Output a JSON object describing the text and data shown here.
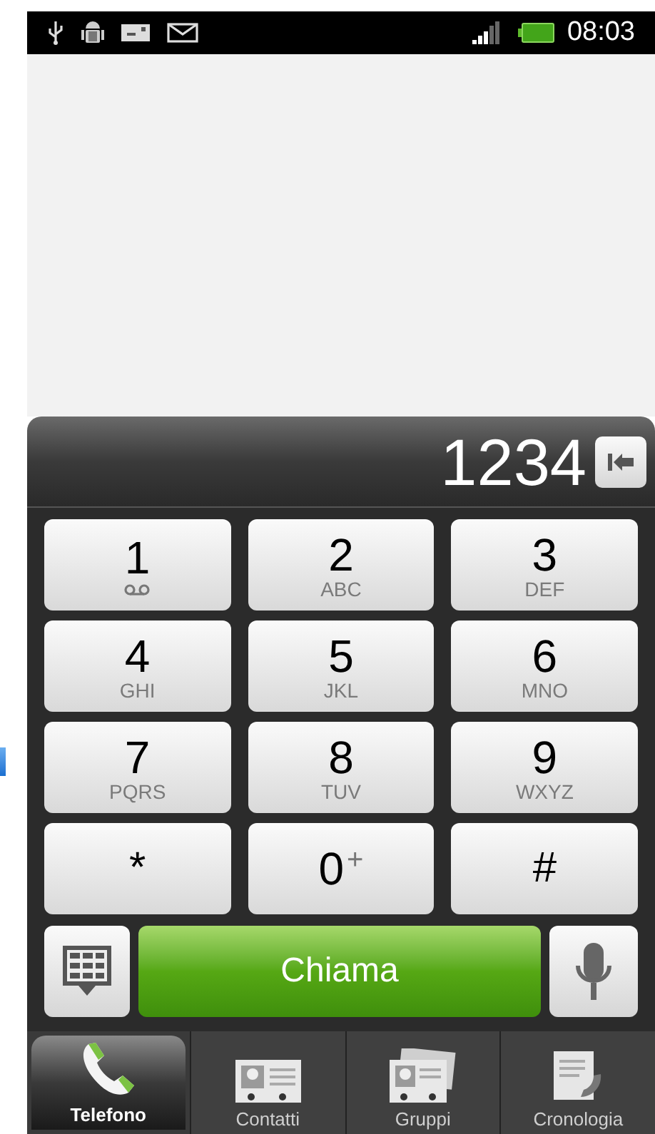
{
  "status_bar": {
    "time": "08:03"
  },
  "dialer": {
    "number": "1234"
  },
  "keys": [
    {
      "digit": "1",
      "kind": "voicemail"
    },
    {
      "digit": "2",
      "letters": "ABC",
      "kind": "digit"
    },
    {
      "digit": "3",
      "letters": "DEF",
      "kind": "digit"
    },
    {
      "digit": "4",
      "letters": "GHI",
      "kind": "digit"
    },
    {
      "digit": "5",
      "letters": "JKL",
      "kind": "digit"
    },
    {
      "digit": "6",
      "letters": "MNO",
      "kind": "digit"
    },
    {
      "digit": "7",
      "letters": "PQRS",
      "kind": "digit"
    },
    {
      "digit": "8",
      "letters": "TUV",
      "kind": "digit"
    },
    {
      "digit": "9",
      "letters": "WXYZ",
      "kind": "digit"
    },
    {
      "digit": "*",
      "kind": "symbol"
    },
    {
      "digit": "0",
      "letters": "+",
      "kind": "plus"
    },
    {
      "digit": "#",
      "kind": "symbol"
    }
  ],
  "call_button": {
    "label": "Chiama"
  },
  "tabs": [
    {
      "label": "Telefono",
      "selected": true,
      "kind": "phone"
    },
    {
      "label": "Contatti",
      "selected": false,
      "kind": "contacts"
    },
    {
      "label": "Gruppi",
      "selected": false,
      "kind": "groups"
    },
    {
      "label": "Cronologia",
      "selected": false,
      "kind": "history"
    }
  ]
}
